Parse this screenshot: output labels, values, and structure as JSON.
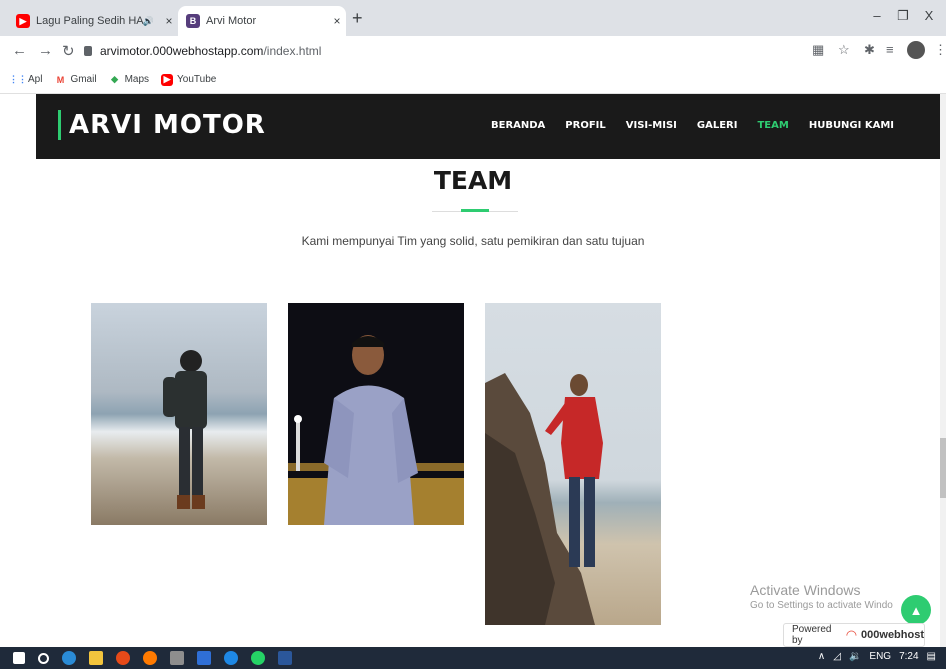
{
  "browser": {
    "tabs": [
      {
        "title": "Lagu Paling Sedih HAPPY AS",
        "favicon_color": "#ff0000",
        "active": false
      },
      {
        "title": "Arvi Motor",
        "favicon_letter": "B",
        "favicon_color": "#563d7c",
        "active": true
      }
    ],
    "new_tab_label": "+",
    "window_controls": {
      "minimize": "–",
      "maximize": "❐",
      "close": "X"
    },
    "url_host": "arvimotor.000webhostapp.com",
    "url_path": "/index.html",
    "bookmarks": [
      {
        "label": "Apl",
        "icon": "apps-grid-icon"
      },
      {
        "label": "Gmail",
        "icon": "gmail-icon"
      },
      {
        "label": "Maps",
        "icon": "maps-icon"
      },
      {
        "label": "YouTube",
        "icon": "youtube-icon"
      }
    ]
  },
  "site": {
    "brand": "ARVI MOTOR",
    "menu": [
      "BERANDA",
      "PROFIL",
      "VISI-MISI",
      "GALERI",
      "TEAM",
      "HUBUNGI KAMI"
    ],
    "active_menu": "TEAM",
    "accent_color": "#2ecc71"
  },
  "team": {
    "title": "TEAM",
    "subtitle": "Kami mempunyai Tim yang solid, satu pemikiran dan satu tujuan",
    "photos": [
      "team-member-1-photo",
      "team-member-2-photo",
      "team-member-3-photo"
    ]
  },
  "overlay": {
    "activate_title": "Activate Windows",
    "activate_sub": "Go to Settings to activate Windo",
    "powered_by": "Powered by",
    "powered_brand": "000webhost"
  },
  "taskbar": {
    "lang": "ENG",
    "time": "7:24"
  }
}
